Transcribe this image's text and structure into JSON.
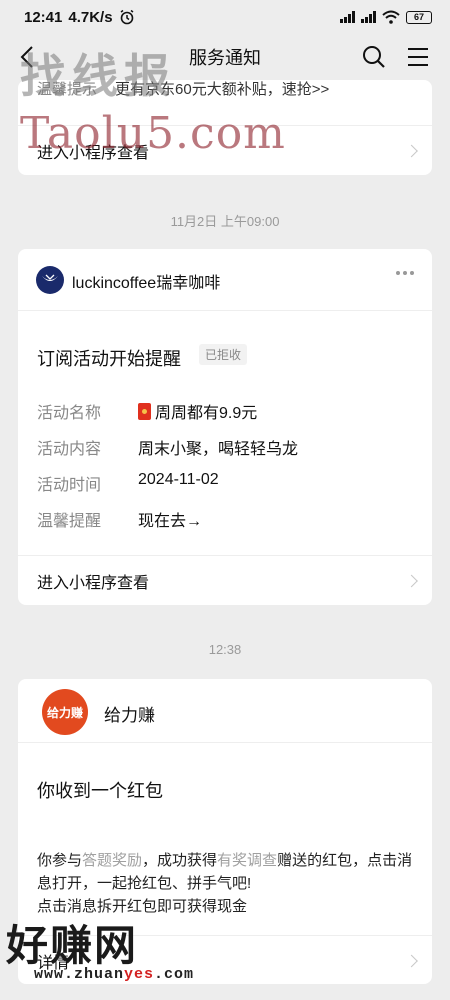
{
  "status": {
    "time": "12:41",
    "speed": "4.7K/s",
    "battery": "67"
  },
  "nav": {
    "title": "服务通知"
  },
  "watermarks": {
    "top1": "找线报",
    "top2": "Taolu5.com",
    "bottom1": "好赚网",
    "bottom2_a": "www.zhuan",
    "bottom2_b": "yes",
    "bottom2_c": ".com"
  },
  "card1": {
    "cut_label": "温馨提示",
    "cut_text": "更有京东60元大额补贴，速抢>>",
    "enter": "进入小程序查看"
  },
  "time1": "11月2日 上午09:00",
  "card2": {
    "brand": "luckincoffee瑞幸咖啡",
    "title": "订阅活动开始提醒",
    "badge": "已拒收",
    "fields": [
      {
        "label": "活动名称",
        "value": "周周都有9.9元"
      },
      {
        "label": "活动内容",
        "value": "周末小聚，喝轻轻乌龙"
      },
      {
        "label": "活动时间",
        "value": "2024-11-02"
      },
      {
        "label": "温馨提醒",
        "value": "现在去→"
      }
    ],
    "enter": "进入小程序查看"
  },
  "time2": "12:38",
  "card3": {
    "logo_text": "给力赚",
    "brand": "给力赚",
    "title": "你收到一个红包",
    "body_a": "你参与",
    "body_link1": "答题奖励",
    "body_b": "，成功获得",
    "body_link2": "有奖调查",
    "body_c": "赠送的红包，点击消息打开，一起抢红包、拼手气吧!",
    "body_line2": "点击消息拆开红包即可获得现金",
    "enter": "详情"
  }
}
